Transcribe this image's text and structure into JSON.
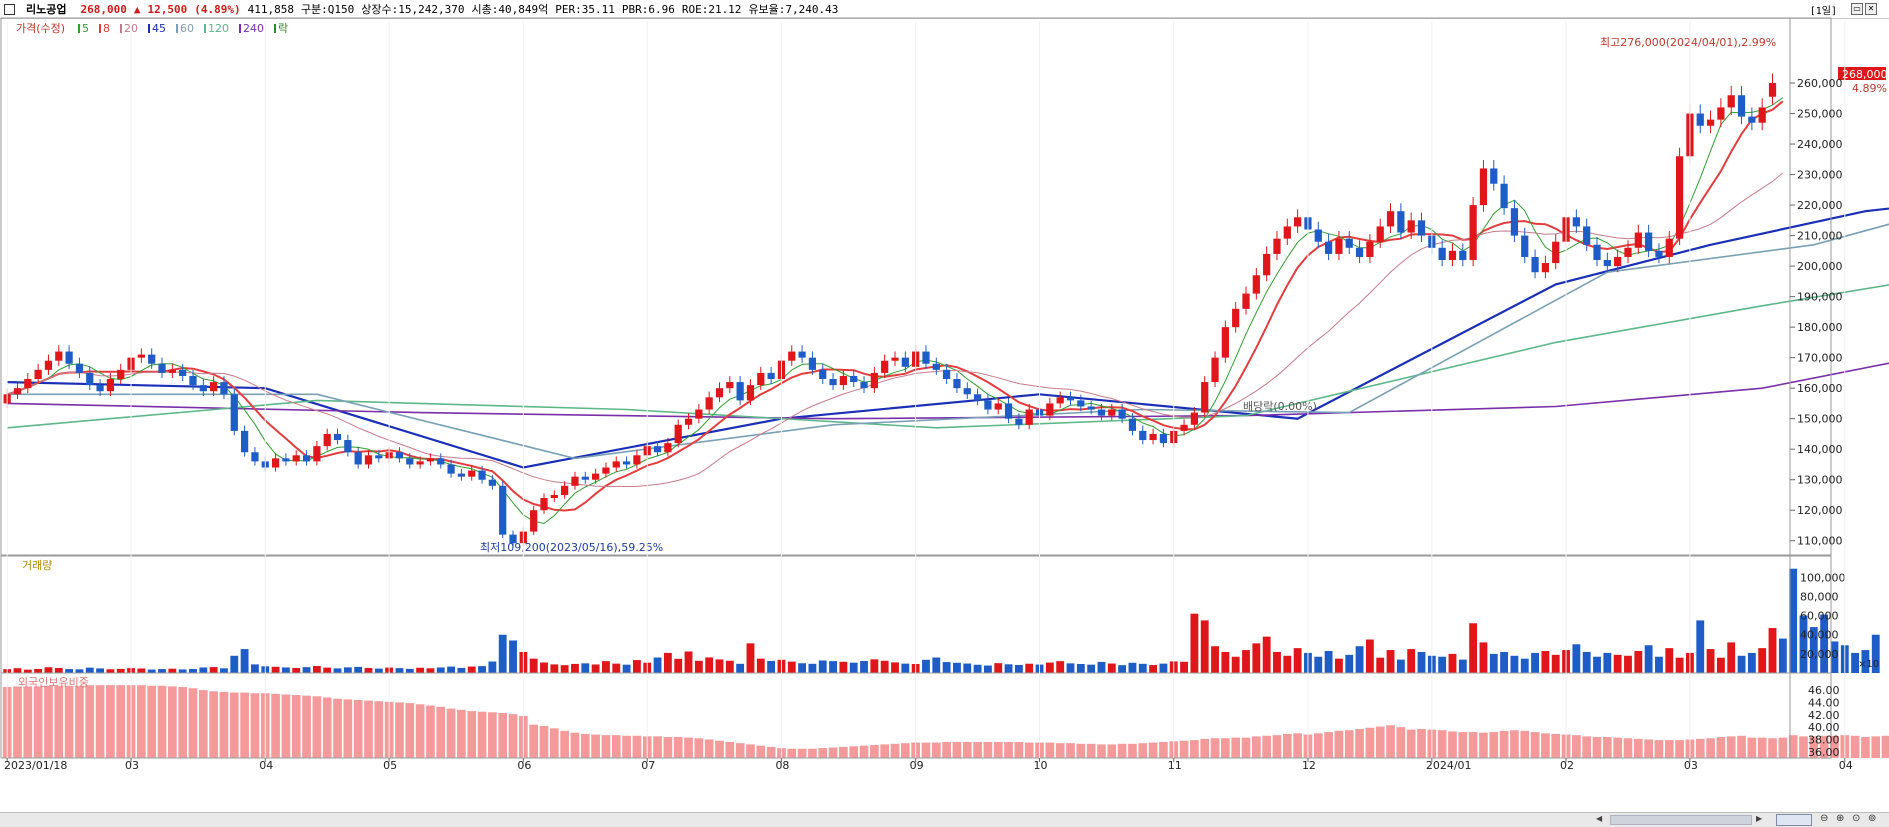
{
  "header": {
    "stock_name": "리노공업",
    "price": "268,000",
    "change_arrow": "▲",
    "change": "12,500",
    "change_pct": "(4.89%)",
    "volume": "411,858",
    "market": "구분:Q150",
    "shares": "상장수:15,242,370",
    "market_cap": "시총:40,849억",
    "per": "PER:35.11",
    "pbr": "PBR:6.96",
    "roe": "ROE:21.12",
    "float": "유보율:7,240.43",
    "period": "[1일]"
  },
  "colors": {
    "up": "#e0161a",
    "down": "#1e5cc8",
    "ma5": "#2fa02f",
    "ma8": "#e33d3d",
    "ma20": "#c87a8a",
    "ma45": "#1a2fb8",
    "ma60": "#7aa0b5",
    "ma120": "#5cb888",
    "ma240": "#7a2faa",
    "foreign": "#f59a9a"
  },
  "price_legend": {
    "price_label": "가격(수정)",
    "items": [
      {
        "label": "5",
        "color": "#2fa02f"
      },
      {
        "label": "8",
        "color": "#e33d3d"
      },
      {
        "label": "20",
        "color": "#c87a8a"
      },
      {
        "label": "45",
        "color": "#1a2fb8"
      },
      {
        "label": "60",
        "color": "#7aa0b5"
      },
      {
        "label": "120",
        "color": "#5cb888"
      },
      {
        "label": "240",
        "color": "#7a2faa"
      },
      {
        "label": "락",
        "color": "#2a8a2a"
      }
    ]
  },
  "volume_legend": "거래량",
  "foreign_legend": "외국인보유비중",
  "annotations": {
    "high": "최고276,000(2024/04/01),2.99%",
    "low": "최저109,200(2023/05/16),59.25%",
    "ex_div": "배당락(0.00%)",
    "last_price": "268,000",
    "last_pct": "4.89%"
  },
  "axis": {
    "price_ticks": [
      "260,000",
      "250,000",
      "240,000",
      "230,000",
      "220,000",
      "210,000",
      "200,000",
      "190,000",
      "180,000",
      "170,000",
      "160,000",
      "150,000",
      "140,000",
      "130,000",
      "120,000",
      "110,000"
    ],
    "volume_ticks": [
      "100,000",
      "80,000",
      "60,000",
      "40,000",
      "20,000"
    ],
    "volume_unit": "×10",
    "foreign_ticks": [
      "46.00",
      "44.00",
      "42.00",
      "40.00",
      "38.00",
      "36.00"
    ],
    "date_ticks": [
      "2023/01/18",
      "03",
      "04",
      "05",
      "06",
      "07",
      "08",
      "09",
      "10",
      "11",
      "12",
      "2024/01",
      "02",
      "03",
      "04"
    ]
  },
  "chart_data": [
    {
      "type": "candlestick",
      "title": "가격(수정)",
      "ylim": [
        105000,
        280000
      ],
      "x_labels": [
        "2023/01/18",
        "03",
        "04",
        "05",
        "06",
        "07",
        "08",
        "09",
        "10",
        "11",
        "12",
        "2024/01",
        "02",
        "03",
        "04"
      ],
      "closes": [
        158000,
        160000,
        163000,
        166000,
        169000,
        172000,
        168000,
        165000,
        161000,
        159000,
        163000,
        166000,
        170000,
        171000,
        168000,
        165000,
        166000,
        164000,
        161000,
        159000,
        162000,
        158000,
        146000,
        139000,
        136000,
        134000,
        137000,
        136000,
        138000,
        136000,
        141000,
        145000,
        143000,
        139000,
        135000,
        138000,
        137000,
        139000,
        137000,
        135000,
        136000,
        137000,
        135000,
        132000,
        131000,
        133000,
        130000,
        128000,
        112000,
        109200,
        113000,
        120000,
        124000,
        125000,
        128000,
        131000,
        130000,
        132000,
        134000,
        136000,
        135000,
        138000,
        141000,
        139000,
        142000,
        148000,
        150000,
        153000,
        157000,
        160000,
        162000,
        156000,
        161000,
        165000,
        163000,
        169000,
        172000,
        170000,
        166000,
        163000,
        161000,
        164000,
        162000,
        160000,
        165000,
        169000,
        170000,
        167000,
        172000,
        168000,
        166000,
        163000,
        160000,
        158000,
        156000,
        153000,
        155000,
        150000,
        148000,
        153000,
        151000,
        155000,
        157000,
        156000,
        154000,
        153000,
        151000,
        153000,
        150000,
        146000,
        143000,
        145000,
        142000,
        146000,
        148000,
        152000,
        162000,
        170000,
        180000,
        186000,
        191000,
        197000,
        204000,
        209000,
        213000,
        216000,
        212000,
        208000,
        204000,
        209000,
        206000,
        203000,
        208000,
        213000,
        218000,
        211000,
        215000,
        210000,
        206000,
        202000,
        205000,
        202000,
        220000,
        232000,
        227000,
        219000,
        210000,
        203000,
        198000,
        201000,
        208000,
        216000,
        213000,
        207000,
        202000,
        200000,
        203000,
        206000,
        211000,
        205000,
        203000,
        209000,
        236000,
        250000,
        246000,
        248000,
        252000,
        256000,
        249000,
        247000,
        252000,
        260000,
        268000
      ],
      "opens": [
        155000,
        158000,
        160000,
        163000,
        166000,
        169000,
        172000,
        168000,
        165000,
        161000,
        159000,
        163000,
        166000,
        170000,
        171000,
        168000,
        165000,
        166000,
        164000,
        161000,
        159000,
        162000,
        158000,
        146000,
        139000,
        136000,
        134000,
        137000,
        136000,
        138000,
        136000,
        141000,
        145000,
        143000,
        139000,
        135000,
        138000,
        137000,
        139000,
        137000,
        135000,
        136000,
        137000,
        135000,
        132000,
        131000,
        133000,
        130000,
        128000,
        112000,
        109200,
        113000,
        120000,
        124000,
        125000,
        128000,
        131000,
        130000,
        132000,
        134000,
        136000,
        135000,
        138000,
        141000,
        139000,
        142000,
        148000,
        150000,
        153000,
        157000,
        160000,
        162000,
        156000,
        161000,
        165000,
        163000,
        169000,
        172000,
        170000,
        166000,
        163000,
        161000,
        164000,
        162000,
        160000,
        165000,
        169000,
        170000,
        167000,
        172000,
        168000,
        166000,
        163000,
        160000,
        158000,
        156000,
        153000,
        155000,
        150000,
        148000,
        153000,
        151000,
        155000,
        157000,
        156000,
        154000,
        153000,
        151000,
        153000,
        150000,
        146000,
        143000,
        145000,
        142000,
        146000,
        148000,
        152000,
        162000,
        170000,
        180000,
        186000,
        191000,
        197000,
        204000,
        209000,
        213000,
        216000,
        212000,
        208000,
        204000,
        209000,
        206000,
        203000,
        208000,
        213000,
        218000,
        211000,
        215000,
        210000,
        206000,
        202000,
        205000,
        202000,
        220000,
        232000,
        227000,
        219000,
        210000,
        203000,
        198000,
        201000,
        208000,
        216000,
        213000,
        207000,
        202000,
        200000,
        203000,
        206000,
        211000,
        205000,
        203000,
        209000,
        236000,
        250000,
        246000,
        248000,
        252000,
        256000,
        249000,
        247000,
        255500
      ],
      "ma_series": [
        {
          "name": "45",
          "points": [
            [
              0,
              162000
            ],
            [
              25,
              160000
            ],
            [
              50,
              134000
            ],
            [
              75,
              150000
            ],
            [
              100,
              158000
            ],
            [
              125,
              150000
            ],
            [
              150,
              194000
            ],
            [
              165,
              207000
            ],
            [
              180,
              218000
            ],
            [
              188,
              221000
            ]
          ]
        },
        {
          "name": "240",
          "points": [
            [
              0,
              155000
            ],
            [
              40,
              152000
            ],
            [
              80,
              150000
            ],
            [
              120,
              151000
            ],
            [
              150,
              154000
            ],
            [
              170,
              160000
            ],
            [
              188,
              172000
            ]
          ]
        },
        {
          "name": "120",
          "points": [
            [
              0,
              147000
            ],
            [
              30,
              156000
            ],
            [
              60,
              153000
            ],
            [
              90,
              147000
            ],
            [
              120,
              151000
            ],
            [
              150,
              175000
            ],
            [
              170,
              187000
            ],
            [
              188,
              197000
            ]
          ]
        },
        {
          "name": "60",
          "points": [
            [
              0,
              158000
            ],
            [
              30,
              158000
            ],
            [
              55,
              137000
            ],
            [
              80,
              148000
            ],
            [
              110,
              153000
            ],
            [
              130,
              152000
            ],
            [
              155,
              198000
            ],
            [
              175,
              207000
            ],
            [
              188,
              219000
            ]
          ]
        }
      ]
    },
    {
      "type": "bar",
      "title": "거래량",
      "ylim": [
        0,
        115000
      ],
      "unit": "×10",
      "values": [
        4000,
        5000,
        3500,
        4200,
        6000,
        5200,
        4100,
        3800,
        5600,
        4800,
        3900,
        4300,
        5100,
        4700,
        3600,
        4100,
        4500,
        3700,
        4200,
        5800,
        6200,
        4900,
        18000,
        25000,
        9000,
        7000,
        6500,
        5800,
        5200,
        6100,
        7300,
        5600,
        4800,
        5900,
        6400,
        5200,
        4600,
        5700,
        5100,
        4300,
        5500,
        4900,
        5800,
        6700,
        5300,
        6800,
        7200,
        12000,
        40000,
        34000,
        22000,
        15000,
        11000,
        9000,
        8200,
        9500,
        10100,
        8900,
        12400,
        9800,
        8700,
        13500,
        10800,
        16200,
        21000,
        14800,
        22500,
        12700,
        16300,
        14200,
        12800,
        9600,
        31000,
        15000,
        12600,
        13800,
        11900,
        10200,
        9600,
        13100,
        12400,
        11700,
        10800,
        12600,
        14300,
        12800,
        11100,
        9800,
        9400,
        13800,
        16200,
        11400,
        10700,
        9900,
        8600,
        7800,
        10300,
        9100,
        8400,
        9700,
        8800,
        10900,
        12400,
        10100,
        9400,
        8700,
        11600,
        9900,
        8200,
        10700,
        9600,
        8300,
        9800,
        12100,
        11700,
        62000,
        55000,
        28000,
        22000,
        17000,
        24000,
        31000,
        38000,
        22000,
        18000,
        26000,
        21000,
        17000,
        23000,
        15000,
        19000,
        28000,
        35000,
        16000,
        24000,
        14000,
        25000,
        22000,
        18000,
        17000,
        20000,
        14000,
        52000,
        32000,
        20000,
        22000,
        18000,
        15000,
        21000,
        23000,
        19000,
        24000,
        30000,
        22000,
        17000,
        21000,
        19000,
        18000,
        23000,
        29000,
        17000,
        26000,
        16000,
        21000,
        55000,
        25000,
        16000,
        32000,
        18000,
        21000,
        26000,
        47000,
        36000,
        109000,
        60000,
        48000,
        61000,
        33000,
        29000,
        21000,
        24000,
        40000
      ],
      "x_labels": [
        "2023/01/18",
        "03",
        "04",
        "05",
        "06",
        "07",
        "08",
        "09",
        "10",
        "11",
        "12",
        "2024/01",
        "02",
        "03",
        "04"
      ]
    },
    {
      "type": "bar",
      "title": "외국인보유비중",
      "ylim": [
        35.0,
        47.8
      ],
      "values": [
        46.5,
        46.6,
        46.6,
        46.6,
        46.7,
        46.7,
        46.7,
        46.7,
        46.8,
        46.8,
        46.8,
        46.8,
        46.8,
        46.8,
        46.7,
        46.7,
        46.6,
        46.5,
        46.3,
        46.0,
        45.8,
        45.7,
        45.6,
        45.6,
        45.5,
        45.5,
        45.4,
        45.3,
        45.2,
        45.1,
        45.0,
        44.8,
        44.6,
        44.5,
        44.4,
        44.3,
        44.2,
        44.1,
        44.0,
        43.9,
        43.7,
        43.5,
        43.3,
        43.0,
        42.8,
        42.6,
        42.5,
        42.4,
        42.3,
        42.1,
        41.8,
        40.4,
        40.2,
        39.8,
        39.4,
        39.1,
        38.9,
        38.8,
        38.7,
        38.7,
        38.6,
        38.6,
        38.5,
        38.5,
        38.4,
        38.4,
        38.3,
        38.2,
        38.0,
        37.8,
        37.6,
        37.4,
        37.2,
        37.0,
        36.8,
        36.6,
        36.5,
        36.5,
        36.5,
        36.6,
        36.7,
        36.8,
        36.9,
        37.0,
        37.1,
        37.2,
        37.3,
        37.4,
        37.5,
        37.5,
        37.5,
        37.6,
        37.6,
        37.6,
        37.6,
        37.6,
        37.6,
        37.6,
        37.6,
        37.5,
        37.5,
        37.5,
        37.4,
        37.4,
        37.3,
        37.3,
        37.2,
        37.2,
        37.3,
        37.3,
        37.4,
        37.5,
        37.6,
        37.7,
        37.8,
        37.9,
        38.1,
        38.2,
        38.2,
        38.3,
        38.3,
        38.5,
        38.6,
        38.7,
        38.9,
        39.0,
        38.8,
        39.0,
        39.2,
        39.4,
        39.5,
        39.7,
        39.9,
        40.1,
        40.3,
        40.0,
        39.6,
        39.7,
        39.6,
        39.5,
        39.3,
        39.2,
        39.2,
        39.1,
        39.2,
        39.4,
        39.5,
        39.4,
        39.2,
        39.0,
        38.9,
        38.8,
        38.7,
        38.5,
        38.4,
        38.4,
        38.3,
        38.2,
        38.1,
        38.0,
        37.9,
        37.9,
        37.9,
        38.0,
        38.1,
        38.2,
        38.4,
        38.5,
        38.6,
        38.3,
        38.3,
        38.2,
        38.3,
        38.7,
        38.5,
        38.5,
        38.6,
        38.6,
        38.7,
        38.6,
        38.4,
        38.5,
        38.6,
        38.6,
        38.7,
        38.6,
        38.5,
        38.5
      ],
      "x_labels": [
        "2023/01/18",
        "03",
        "04",
        "05",
        "06",
        "07",
        "08",
        "09",
        "10",
        "11",
        "12",
        "2024/01",
        "02",
        "03",
        "04"
      ]
    }
  ]
}
